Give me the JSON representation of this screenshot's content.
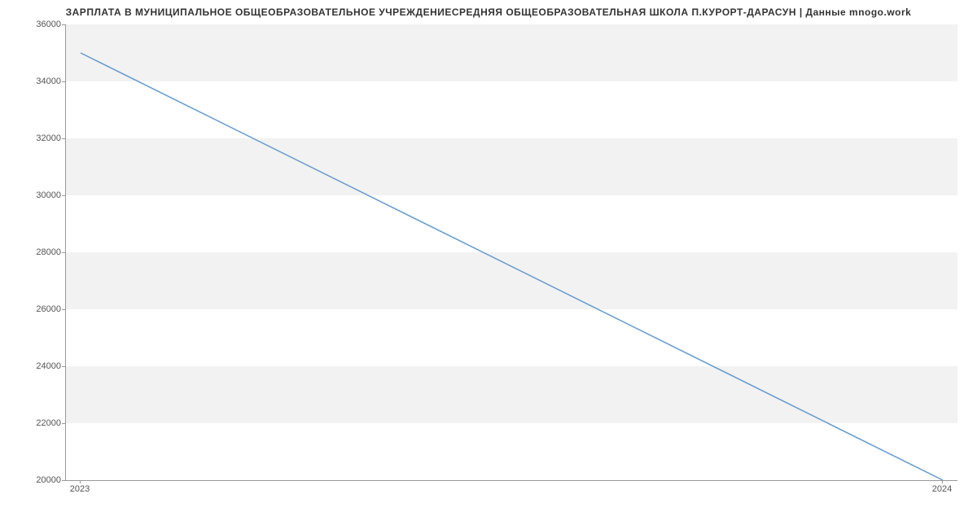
{
  "chart_data": {
    "type": "line",
    "title": "ЗАРПЛАТА В МУНИЦИПАЛЬНОЕ ОБЩЕОБРАЗОВАТЕЛЬНОЕ УЧРЕЖДЕНИЕСРЕДНЯЯ ОБЩЕОБРАЗОВАТЕЛЬНАЯ ШКОЛА П.КУРОРТ-ДАРАСУН | Данные mnogo.work",
    "x": [
      2023,
      2024
    ],
    "values": [
      35000,
      20000
    ],
    "xlabel": "",
    "ylabel": "",
    "ylim": [
      20000,
      36000
    ],
    "xlim": [
      2023,
      2024
    ],
    "y_ticks": [
      20000,
      22000,
      24000,
      26000,
      28000,
      30000,
      32000,
      34000,
      36000
    ],
    "x_ticks": [
      2023,
      2024
    ],
    "line_color": "#6699cc"
  }
}
